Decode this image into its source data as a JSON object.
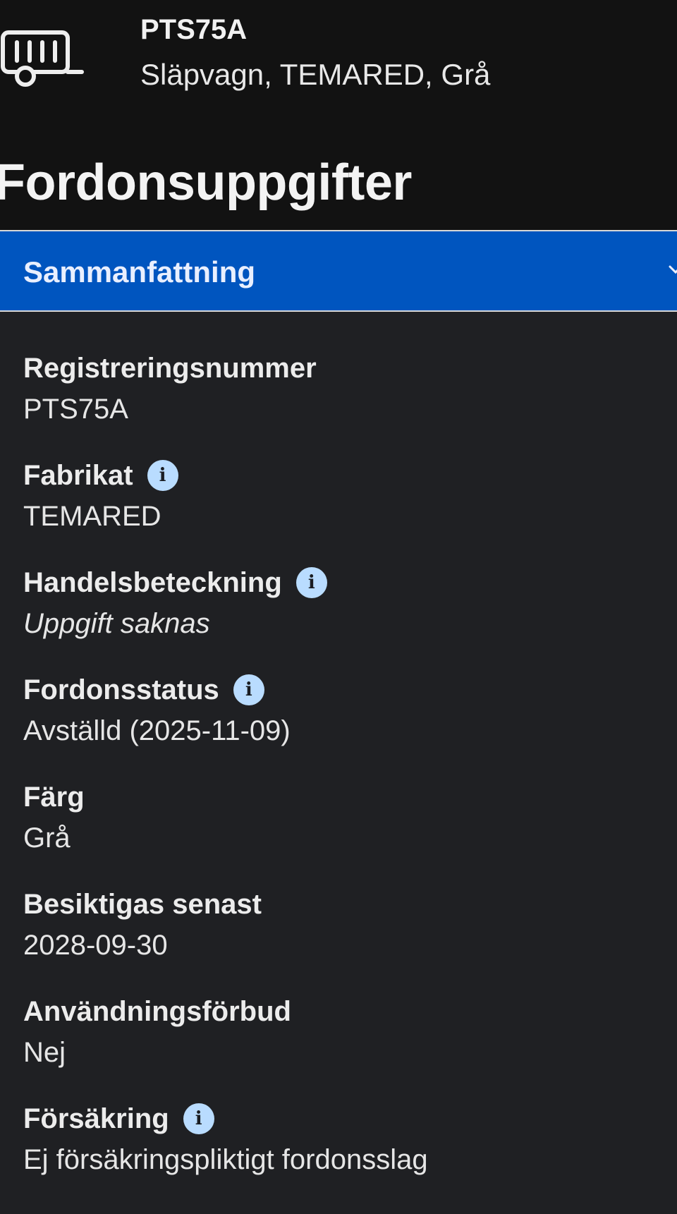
{
  "header": {
    "vehicle_icon": "trailer-icon",
    "plate": "PTS75A",
    "description": "Släpvagn, TEMARED, Grå",
    "page_title": "Fordonsuppgifter"
  },
  "section": {
    "label": "Sammanfattning",
    "chevron": "chevron-down-icon",
    "accent_color": "#0055bf"
  },
  "fields": [
    {
      "label": "Registreringsnummer",
      "value": "PTS75A",
      "has_info": false
    },
    {
      "label": "Fabrikat",
      "value": "TEMARED",
      "has_info": true
    },
    {
      "label": "Handelsbeteckning",
      "value": "Uppgift saknas",
      "has_info": true,
      "italic": true
    },
    {
      "label": "Fordonsstatus",
      "value": "Avställd (2025-11-09)",
      "has_info": true
    },
    {
      "label": "Färg",
      "value": "Grå",
      "has_info": false
    },
    {
      "label": "Besiktigas senast",
      "value": "2028-09-30",
      "has_info": false
    },
    {
      "label": "Användningsförbud",
      "value": "Nej",
      "has_info": false
    },
    {
      "label": "Försäkring",
      "value": "Ej försäkringspliktigt fordonsslag",
      "has_info": true
    }
  ],
  "info_icon_glyph": "i"
}
